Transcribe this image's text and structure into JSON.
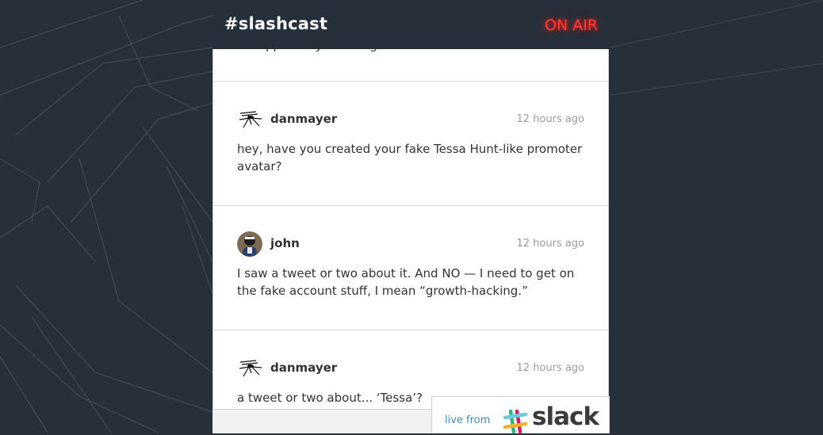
{
  "header": {
    "channel": "#slashcast",
    "status": "ON AIR"
  },
  "partial_message": "it's apparently catching on",
  "messages": [
    {
      "author": "danmayer",
      "time": "12 hours ago",
      "text": "hey, have you created your fake Tessa Hunt-like promoter avatar?",
      "avatar": "mosquito-icon"
    },
    {
      "author": "john",
      "time": "12 hours ago",
      "text": "I saw a tweet or two about it. And NO — I need to get on the fake account stuff, I mean “growth-hacking.”",
      "avatar": "photo-avatar"
    },
    {
      "author": "danmayer",
      "time": "12 hours ago",
      "text": "a tweet or two about... ‘Tessa’?",
      "avatar": "mosquito-icon"
    }
  ],
  "footer": {
    "live_from": "live from",
    "brand": "slack"
  },
  "colors": {
    "background": "#27303a",
    "on_air": "#ff3b30",
    "link": "#3f86c6"
  }
}
